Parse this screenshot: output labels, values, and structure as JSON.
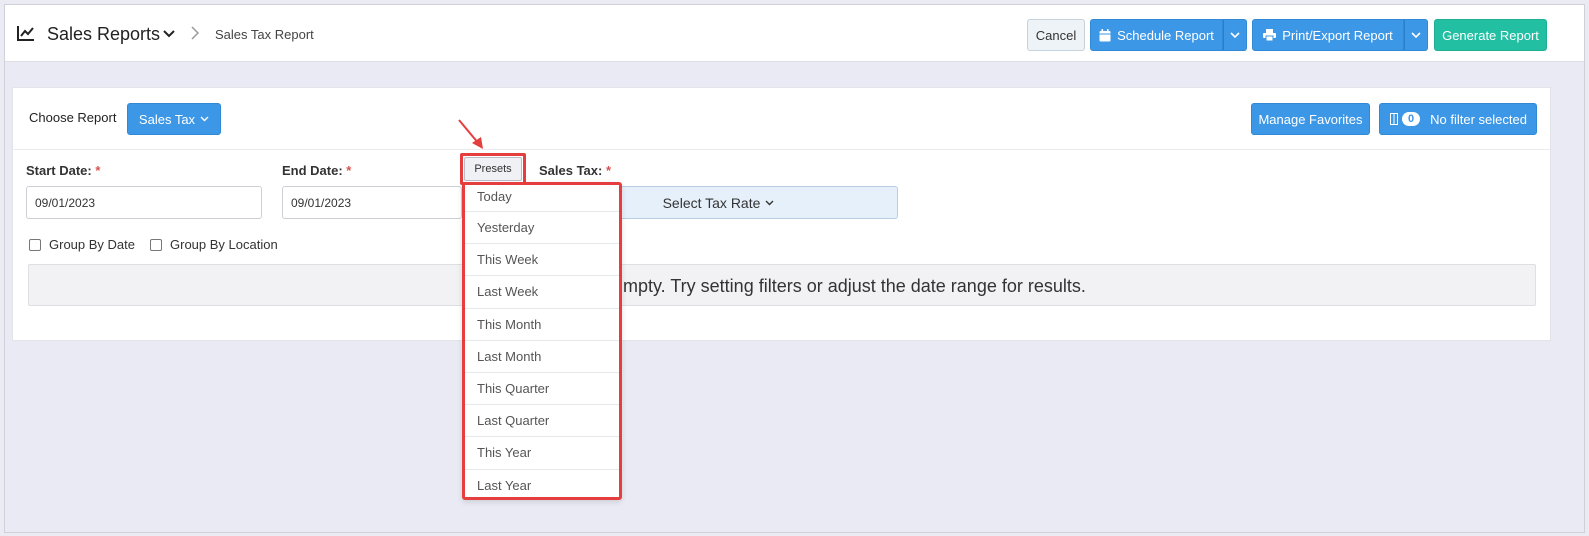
{
  "header": {
    "title": "Sales Reports",
    "breadcrumb_sub": "Sales Tax Report",
    "icons": [
      "chart-line-icon",
      "chevron-down-icon",
      "chevron-right-icon"
    ]
  },
  "toolbar": {
    "cancel": "Cancel",
    "schedule": "Schedule Report",
    "print_export": "Print/Export Report",
    "generate": "Generate Report"
  },
  "report": {
    "choose_label": "Choose Report",
    "selected": "Sales Tax",
    "manage_favorites": "Manage Favorites",
    "filter_count": "0",
    "filter_text": "No filter selected"
  },
  "filters": {
    "start_label": "Start Date:",
    "start_value": "09/01/2023",
    "end_label": "End Date:",
    "end_value": "09/01/2023",
    "presets": "Presets",
    "tax_label": "Sales Tax:",
    "tax_select": "Select Tax Rate",
    "required_mark": "*",
    "group_by_date": "Group By Date",
    "group_by_location": "Group By Location"
  },
  "empty_message": "mpty. Try setting filters or adjust the date range for results.",
  "presets_menu": [
    "Today",
    "Yesterday",
    "This Week",
    "Last Week",
    "This Month",
    "Last Month",
    "This Quarter",
    "Last Quarter",
    "This Year",
    "Last Year"
  ],
  "colors": {
    "primary": "#3c97e6",
    "success": "#22bfa3",
    "highlight": "#e53e3e",
    "required": "#d9534f"
  }
}
